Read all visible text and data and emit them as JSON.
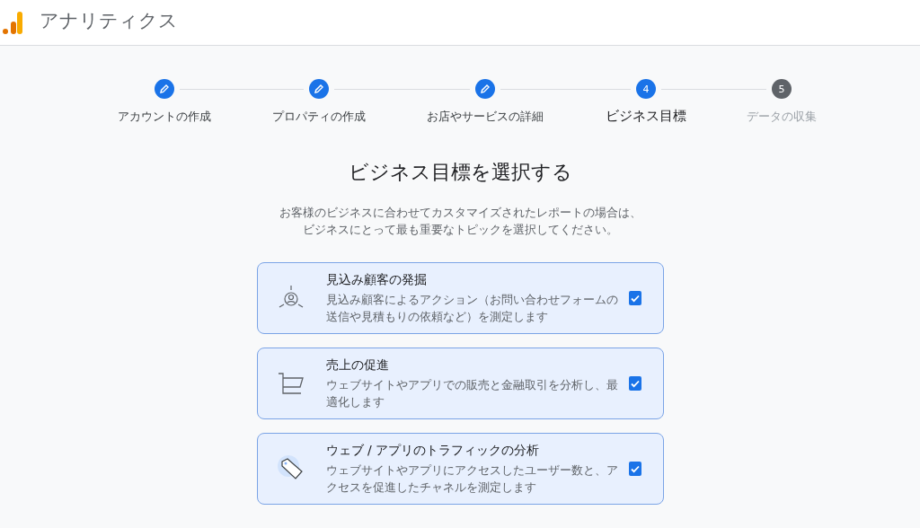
{
  "header": {
    "title": "アナリティクス"
  },
  "steps": [
    {
      "label": "アカウントの作成",
      "completed": true,
      "selected": false
    },
    {
      "label": "プロパティの作成",
      "completed": true,
      "selected": false
    },
    {
      "label": "お店やサービスの詳細",
      "completed": true,
      "selected": false
    },
    {
      "label": "ビジネス目標",
      "completed": false,
      "selected": true,
      "number": "4"
    },
    {
      "label": "データの収集",
      "completed": false,
      "selected": false,
      "number": "5"
    }
  ],
  "heading": "ビジネス目標を選択する",
  "description": [
    "お客様のビジネスに合わせてカスタマイズされたレポートの場合は、",
    "ビジネスにとって最も重要なトピックを選択してください。"
  ],
  "goals": [
    {
      "title": "見込み顧客の発掘",
      "text": "見込み顧客によるアクション（お問い合わせフォームの送信や見積もりの依頼など）を測定します",
      "checked": true
    },
    {
      "title": "売上の促進",
      "text": "ウェブサイトやアプリでの販売と金融取引を分析し、最適化します",
      "checked": true
    },
    {
      "title": "ウェブ / アプリのトラフィックの分析",
      "text": "ウェブサイトやアプリにアクセスしたユーザー数と、アクセスを促進したチャネルを測定します",
      "checked": true
    }
  ]
}
